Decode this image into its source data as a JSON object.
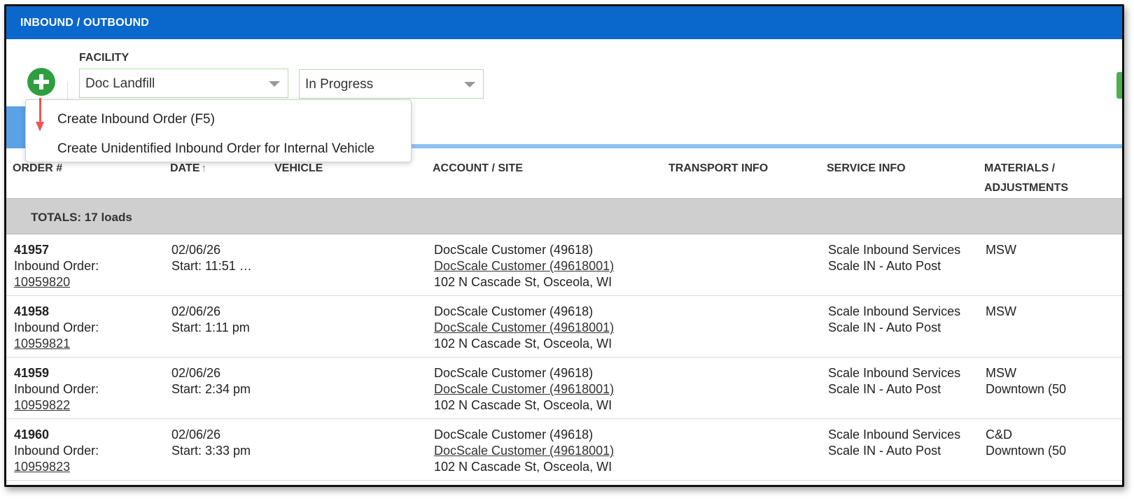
{
  "header": {
    "title": "INBOUND / OUTBOUND"
  },
  "filters": {
    "facility_label": "FACILITY",
    "facility_value": "Doc Landfill",
    "status_value": "In Progress"
  },
  "add_menu": {
    "items": [
      {
        "label": "Create Inbound Order (F5)"
      },
      {
        "label": "Create Unidentified Inbound Order for Internal Vehicle"
      }
    ]
  },
  "table": {
    "columns": [
      "ORDER #",
      "DATE",
      "VEHICLE",
      "ACCOUNT / SITE",
      "TRANSPORT INFO",
      "SERVICE INFO",
      "MATERIALS /",
      "ADJUSTMENTS"
    ],
    "totals": "TOTALS: 17 loads",
    "rows": [
      {
        "order": "41957",
        "order_label": "Inbound Order:",
        "order_link": "10959820",
        "date": "02/06/26",
        "start": "Start: 11:51 …",
        "account": "DocScale Customer (49618)",
        "site": "DocScale Customer (49618001)",
        "address": "102 N Cascade St, Osceola, WI",
        "service1": "Scale Inbound Services",
        "service2": "Scale IN - Auto Post",
        "material1": "MSW",
        "material2": ""
      },
      {
        "order": "41958",
        "order_label": "Inbound Order:",
        "order_link": "10959821",
        "date": "02/06/26",
        "start": "Start: 1:11 pm",
        "account": "DocScale Customer (49618)",
        "site": "DocScale Customer (49618001)",
        "address": "102 N Cascade St, Osceola, WI",
        "service1": "Scale Inbound Services",
        "service2": "Scale IN - Auto Post",
        "material1": "MSW",
        "material2": ""
      },
      {
        "order": "41959",
        "order_label": "Inbound Order:",
        "order_link": "10959822",
        "date": "02/06/26",
        "start": "Start: 2:34 pm",
        "account": "DocScale Customer (49618)",
        "site": "DocScale Customer (49618001)",
        "address": "102 N Cascade St, Osceola, WI",
        "service1": "Scale Inbound Services",
        "service2": "Scale IN - Auto Post",
        "material1": "MSW",
        "material2": "Downtown (50"
      },
      {
        "order": "41960",
        "order_label": "Inbound Order:",
        "order_link": "10959823",
        "date": "02/06/26",
        "start": "Start: 3:33 pm",
        "account": "DocScale Customer (49618)",
        "site": "DocScale Customer (49618001)",
        "address": "102 N Cascade St, Osceola, WI",
        "service1": "Scale Inbound Services",
        "service2": "Scale IN - Auto Post",
        "material1": "C&D",
        "material2": "Downtown (50"
      }
    ]
  },
  "icons": {
    "add": "plus-circle-icon",
    "sort": "sort-up-icon",
    "dropdown": "caret-down-icon"
  },
  "colors": {
    "header_bg": "#0a68cc",
    "add_button": "#2f9e3f",
    "totals_bg": "#cfcfcf",
    "annotation_arrow": "#e55555"
  }
}
